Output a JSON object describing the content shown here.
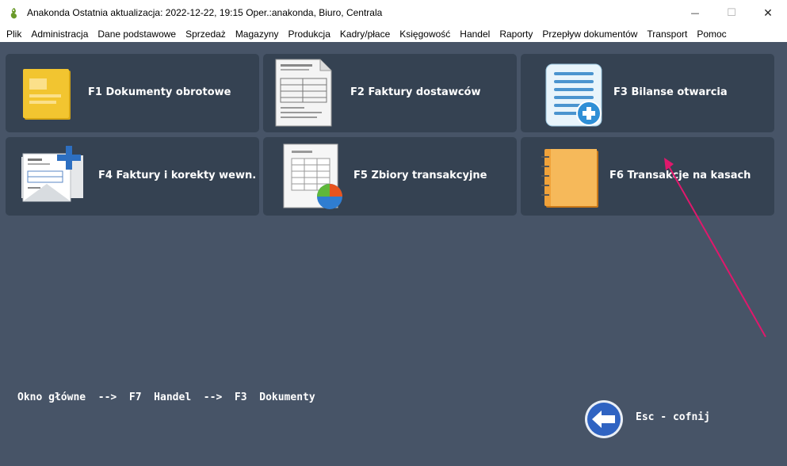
{
  "window": {
    "title": "Anakonda Ostatnia aktualizacja: 2022-12-22, 19:15 Oper.:anakonda, Biuro, Centrala",
    "minimize_glyph": "—",
    "maximize_glyph": "☐",
    "close_glyph": "✕"
  },
  "menu": [
    "Plik",
    "Administracja",
    "Dane podstawowe",
    "Sprzedaż",
    "Magazyny",
    "Produkcja",
    "Kadry/płace",
    "Księgowość",
    "Handel",
    "Raporty",
    "Przepływ dokumentów",
    "Transport",
    "Pomoc"
  ],
  "tiles": [
    {
      "label": "F1  Dokumenty obrotowe",
      "icon": "notepad-icon"
    },
    {
      "label": "F2  Faktury dostawców",
      "icon": "invoice-document-icon"
    },
    {
      "label": "F3  Bilanse otwarcia",
      "icon": "list-add-icon"
    },
    {
      "label": "F4  Faktury i korekty wewn.",
      "icon": "invoice-plus-icon"
    },
    {
      "label": "F5  Zbiory transakcyjne",
      "icon": "spreadsheet-chart-icon"
    },
    {
      "label": "F6  Transakcje na kasach",
      "icon": "notebook-icon"
    }
  ],
  "breadcrumb": "Okno główne  -->  F7  Handel  -->  F3  Dokumenty",
  "back": {
    "label": "Esc - cofnij",
    "icon": "back-arrow-icon"
  },
  "colors": {
    "background": "#475467",
    "tile": "#354252",
    "annotation": "#e0186c"
  }
}
